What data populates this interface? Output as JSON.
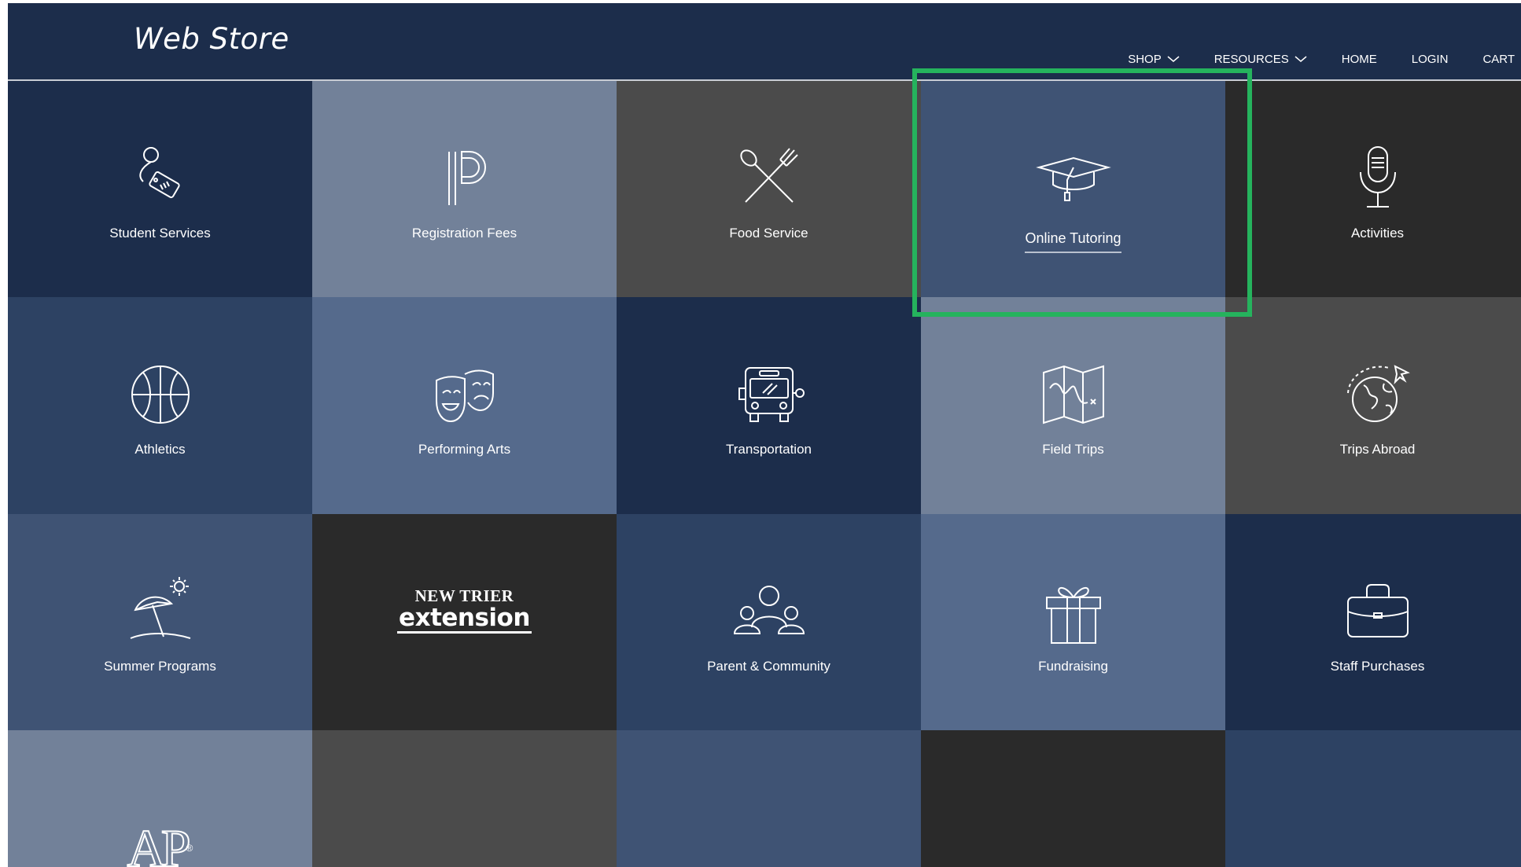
{
  "header": {
    "brand": "Web Store",
    "nav": [
      {
        "label": "SHOP",
        "has_dropdown": true
      },
      {
        "label": "RESOURCES",
        "has_dropdown": true
      },
      {
        "label": "HOME",
        "has_dropdown": false
      },
      {
        "label": "LOGIN",
        "has_dropdown": false
      },
      {
        "label": "CART",
        "has_dropdown": false
      }
    ]
  },
  "tiles": [
    {
      "label": "Student Services",
      "icon": "tag-icon",
      "color": "#1c2d4b"
    },
    {
      "label": "Registration Fees",
      "icon": "powerschool-icon",
      "color": "#728199"
    },
    {
      "label": "Food Service",
      "icon": "fork-spoon-icon",
      "color": "#4b4b4b"
    },
    {
      "label": "Online Tutoring",
      "icon": "graduation-cap-icon",
      "color": "#3f5374",
      "active": true
    },
    {
      "label": "Activities",
      "icon": "microphone-icon",
      "color": "#2a2a2a"
    },
    {
      "label": "Athletics",
      "icon": "basketball-icon",
      "color": "#2d4263"
    },
    {
      "label": "Performing Arts",
      "icon": "theater-masks-icon",
      "color": "#556a8c"
    },
    {
      "label": "Transportation",
      "icon": "bus-icon",
      "color": "#1c2d4b"
    },
    {
      "label": "Field Trips",
      "icon": "map-icon",
      "color": "#728199"
    },
    {
      "label": "Trips Abroad",
      "icon": "globe-plane-icon",
      "color": "#4b4b4b"
    },
    {
      "label": "Summer Programs",
      "icon": "beach-umbrella-icon",
      "color": "#3f5374"
    },
    {
      "label": "",
      "icon": "new-trier-extension-logo",
      "color": "#2a2a2a",
      "logo_top": "NEW TRIER",
      "logo_main": "extension"
    },
    {
      "label": "Parent & Community",
      "icon": "people-group-icon",
      "color": "#2d4263"
    },
    {
      "label": "Fundraising",
      "icon": "gift-icon",
      "color": "#556a8c"
    },
    {
      "label": "Staff Purchases",
      "icon": "briefcase-icon",
      "color": "#1c2d4b"
    },
    {
      "label": "",
      "icon": "ap-logo-icon",
      "color": "#728199",
      "logo_text": "AP",
      "logo_mark": "®"
    },
    {
      "label": "",
      "icon": "",
      "color": "#4b4b4b"
    },
    {
      "label": "",
      "icon": "",
      "color": "#3f5374"
    },
    {
      "label": "",
      "icon": "",
      "color": "#2a2a2a"
    },
    {
      "label": "",
      "icon": "",
      "color": "#2d4263"
    }
  ],
  "highlight_color": "#25b35d"
}
